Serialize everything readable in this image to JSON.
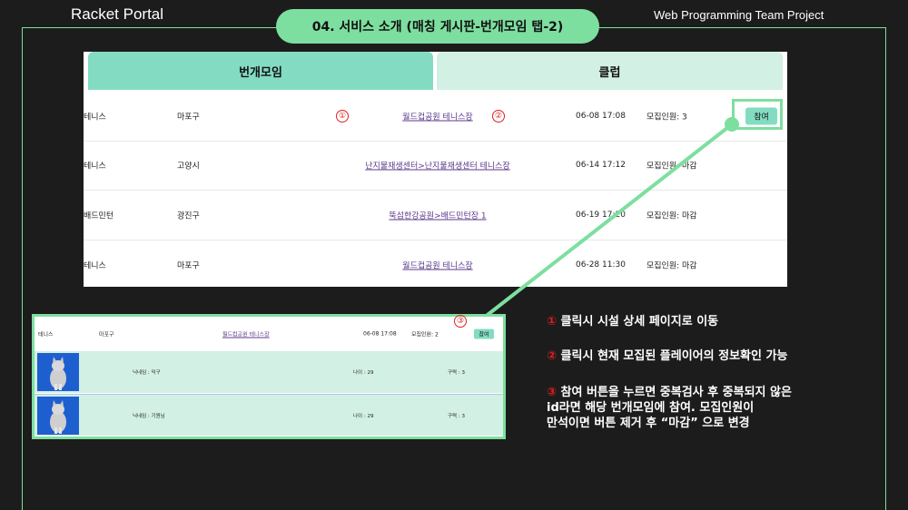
{
  "header": {
    "left_title": "Racket Portal",
    "right_title": "Web Programming Team Project",
    "section_title": "04. 서비스 소개 (매칭 게시판-번개모임 탭-2)"
  },
  "tabs": [
    {
      "label": "번개모임",
      "active": true
    },
    {
      "label": "클럽",
      "active": false
    }
  ],
  "rows": [
    {
      "sport": "테니스",
      "region": "마포구",
      "place": "월드컵공원 테니스장",
      "date": "06-08 17:08",
      "recruit": "모집인원: 3",
      "action": "참여"
    },
    {
      "sport": "테니스",
      "region": "고양시",
      "place": "난지물재생센터>난지물재생센터 테니스장",
      "date": "06-14 17:12",
      "recruit": "모집인원: 마감",
      "action": ""
    },
    {
      "sport": "배드민턴",
      "region": "광진구",
      "place": "뚝섬한강공원>배드민턴장 1",
      "date": "06-19 17:20",
      "recruit": "모집인원: 마감",
      "action": ""
    },
    {
      "sport": "테니스",
      "region": "마포구",
      "place": "월드컵공원 테니스장",
      "date": "06-28 11:30",
      "recruit": "모집인원: 마감",
      "action": ""
    }
  ],
  "markers": {
    "m1": "①",
    "m2": "②",
    "m3": "③"
  },
  "detail": {
    "sport": "테니스",
    "region": "마포구",
    "place": "월드컵공원 테니스장",
    "date": "06-08 17:08",
    "recruit": "모집인원: 2",
    "action": "참여",
    "players": [
      {
        "nickname": "닉네임 : 익구",
        "age": "나이 : 29",
        "career": "구력 : 3"
      },
      {
        "nickname": "닉네임 : 기원님",
        "age": "나이 : 29",
        "career": "구력 : 3"
      }
    ]
  },
  "descriptions": {
    "d1_num": "①",
    "d1_text": " 클릭시 시설 상세 페이지로 이동",
    "d2_num": "②",
    "d2_text": " 클릭시 현재 모집된 플레이어의 정보확인 가능",
    "d3_num": "③",
    "d3_line1": " 참여 버튼을 누르면 중복검사 후 중복되지 않은",
    "d3_line2": "id라면 해당 번개모임에 참여. 모집인원이",
    "d3_line3": "만석이면 버튼 제거 후 “마감” 으로 변경"
  },
  "colors": {
    "accent": "#7ddf9f",
    "tab_active": "#83dcc2",
    "tab_inactive": "#d3f0e5",
    "marker": "#e0201f"
  }
}
